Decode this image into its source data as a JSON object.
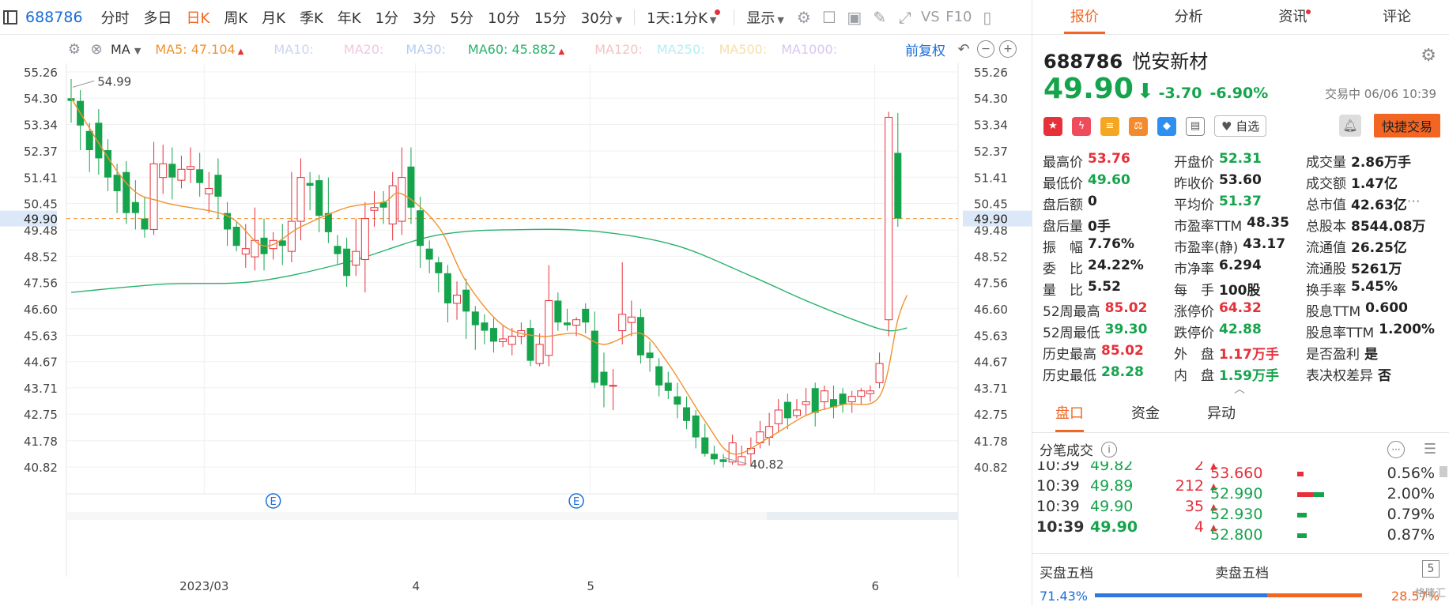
{
  "toolbar": {
    "code": "688786",
    "tabs": [
      "分时",
      "多日",
      "日K",
      "周K",
      "月K",
      "季K",
      "年K",
      "1分",
      "3分",
      "5分",
      "10分",
      "15分",
      "30分"
    ],
    "active_tab": "日K",
    "period": "1天:1分K",
    "display": "显示",
    "vs": "VS",
    "f10": "F10"
  },
  "indicators": {
    "ma_label": "MA",
    "ma5": "MA5: 47.104",
    "ma10": "MA10:",
    "ma20": "MA20:",
    "ma30": "MA30:",
    "ma60": "MA60: 45.882",
    "ma120": "MA120:",
    "ma250": "MA250:",
    "ma500": "MA500:",
    "ma1000": "MA1000:",
    "fuquan": "前复权",
    "colors": {
      "ma5": "#f0922e",
      "ma60": "#27b26b",
      "faded": "#c9d6f0"
    }
  },
  "panel": {
    "tabs": [
      "报价",
      "分析",
      "资讯",
      "评论"
    ],
    "active_tab": "报价",
    "code": "688786",
    "name": "悦安新材",
    "price": "49.90",
    "change": "-3.70",
    "change_pct": "-6.90%",
    "trade_status": "交易中 06/06 10:39",
    "watch": "自选",
    "quick_trade": "快捷交易",
    "stats": [
      [
        {
          "l": "最高价",
          "v": "53.76",
          "c": "red"
        },
        {
          "l": "开盘价",
          "v": "52.31",
          "c": "green"
        },
        {
          "l": "成交量",
          "v": "2.86万手",
          "c": "dark"
        }
      ],
      [
        {
          "l": "最低价",
          "v": "49.60",
          "c": "green"
        },
        {
          "l": "昨收价",
          "v": "53.60",
          "c": "dark"
        },
        {
          "l": "成交额",
          "v": "1.47亿",
          "c": "dark"
        }
      ],
      [
        {
          "l": "盘后额",
          "v": "0",
          "c": "dark"
        },
        {
          "l": "平均价",
          "v": "51.37",
          "c": "green"
        },
        {
          "l": "总市值",
          "v": "42.63亿",
          "c": "dark"
        }
      ],
      [
        {
          "l": "盘后量",
          "v": "0手",
          "c": "dark"
        },
        {
          "l": "市盈率TTM",
          "v": "48.35",
          "c": "dark"
        },
        {
          "l": "总股本",
          "v": "8544.08万",
          "c": "dark"
        }
      ],
      [
        {
          "l": "振　幅",
          "v": "7.76%",
          "c": "dark"
        },
        {
          "l": "市盈率(静)",
          "v": "43.17",
          "c": "dark"
        },
        {
          "l": "流通值",
          "v": "26.25亿",
          "c": "dark"
        }
      ],
      [
        {
          "l": "委　比",
          "v": "24.22%",
          "c": "dark"
        },
        {
          "l": "市净率",
          "v": "6.294",
          "c": "dark"
        },
        {
          "l": "流通股",
          "v": "5261万",
          "c": "dark"
        }
      ],
      [
        {
          "l": "量　比",
          "v": "5.52",
          "c": "dark"
        },
        {
          "l": "每　手",
          "v": "100股",
          "c": "dark"
        },
        {
          "l": "换手率",
          "v": "5.45%",
          "c": "dark"
        }
      ],
      [
        {
          "l": "52周最高",
          "v": "85.02",
          "c": "red"
        },
        {
          "l": "涨停价",
          "v": "64.32",
          "c": "red"
        },
        {
          "l": "股息TTM",
          "v": "0.600",
          "c": "dark"
        }
      ],
      [
        {
          "l": "52周最低",
          "v": "39.30",
          "c": "green"
        },
        {
          "l": "跌停价",
          "v": "42.88",
          "c": "green"
        },
        {
          "l": "股息率TTM",
          "v": "1.200%",
          "c": "dark"
        }
      ],
      [
        {
          "l": "历史最高",
          "v": "85.02",
          "c": "red"
        },
        {
          "l": "外　盘",
          "v": "1.17万手",
          "c": "red"
        },
        {
          "l": "是否盈利",
          "v": "是",
          "c": "dark"
        }
      ],
      [
        {
          "l": "历史最低",
          "v": "28.28",
          "c": "green"
        },
        {
          "l": "内　盘",
          "v": "1.59万手",
          "c": "green"
        },
        {
          "l": "表决权差异",
          "v": "否",
          "c": "dark"
        }
      ]
    ],
    "subtabs": [
      "盘口",
      "资金",
      "异动"
    ],
    "tick_title": "分笔成交",
    "ticks": [
      {
        "t": "10:39",
        "p": "49.82",
        "v": "2"
      },
      {
        "t": "10:39",
        "p": "49.89",
        "v": "212"
      },
      {
        "t": "10:39",
        "p": "49.90",
        "v": "35"
      },
      {
        "t": "10:39",
        "p": "49.90",
        "v": "4"
      }
    ],
    "levels": [
      {
        "p": "53.660",
        "pct": "0.56%"
      },
      {
        "p": "52.990",
        "pct": "2.00%"
      },
      {
        "p": "52.930",
        "pct": "0.79%"
      },
      {
        "p": "52.800",
        "pct": "0.87%"
      }
    ],
    "buy5": "买盘五档",
    "sell5": "卖盘五档",
    "five": "5",
    "buy_pct": "71.43%",
    "sell_pct": "28.57%",
    "watermark": "格隆汇"
  },
  "chart_data": {
    "type": "candlestick",
    "y_ticks": [
      "55.26",
      "54.30",
      "53.34",
      "52.37",
      "51.41",
      "50.45",
      "49.48",
      "48.52",
      "47.56",
      "46.60",
      "45.63",
      "44.67",
      "43.71",
      "42.75",
      "41.78",
      "40.82"
    ],
    "current_price_label": "49.90",
    "high_label": "54.99",
    "low_label": "40.82",
    "x_labels": [
      "2023/03",
      "4",
      "5",
      "6"
    ],
    "candles": [
      [
        54.3,
        54.2,
        55.0,
        53.4
      ],
      [
        54.2,
        53.3,
        54.6,
        52.4
      ],
      [
        53.1,
        52.4,
        53.4,
        51.6
      ],
      [
        53.4,
        52.1,
        53.9,
        51.5
      ],
      [
        52.4,
        51.4,
        52.8,
        50.9
      ],
      [
        51.5,
        50.9,
        51.9,
        50.1
      ],
      [
        51.6,
        50.1,
        52.0,
        49.7
      ],
      [
        50.5,
        50.1,
        51.3,
        49.5
      ],
      [
        49.9,
        49.5,
        50.7,
        49.2
      ],
      [
        49.5,
        51.9,
        52.7,
        49.3
      ],
      [
        51.4,
        51.9,
        52.6,
        50.8
      ],
      [
        51.9,
        51.4,
        52.5,
        50.6
      ],
      [
        51.3,
        51.7,
        52.2,
        51.0
      ],
      [
        51.7,
        51.8,
        52.5,
        51.2
      ],
      [
        51.7,
        51.2,
        52.3,
        50.7
      ],
      [
        50.8,
        51.0,
        51.6,
        50.1
      ],
      [
        51.5,
        50.7,
        52.1,
        49.9
      ],
      [
        50.1,
        49.5,
        50.5,
        48.9
      ],
      [
        49.6,
        48.9,
        49.8,
        48.7
      ],
      [
        48.6,
        48.8,
        49.7,
        48.1
      ],
      [
        48.5,
        49.1,
        50.3,
        48.0
      ],
      [
        49.2,
        48.6,
        49.9,
        48.0
      ],
      [
        48.8,
        49.1,
        49.4,
        48.4
      ],
      [
        49.1,
        48.9,
        49.7,
        48.2
      ],
      [
        48.7,
        49.8,
        51.6,
        48.3
      ],
      [
        49.8,
        51.4,
        52.1,
        49.1
      ],
      [
        51.2,
        51.1,
        51.6,
        50.2
      ],
      [
        51.3,
        50.0,
        51.5,
        49.4
      ],
      [
        50.1,
        49.4,
        51.4,
        49.0
      ],
      [
        48.9,
        48.6,
        49.3,
        48.2
      ],
      [
        48.8,
        47.8,
        49.2,
        47.4
      ],
      [
        48.2,
        48.7,
        49.9,
        47.8
      ],
      [
        48.4,
        49.9,
        50.5,
        47.2
      ],
      [
        50.2,
        50.3,
        50.9,
        49.6
      ],
      [
        50.5,
        50.3,
        50.9,
        49.7
      ],
      [
        49.7,
        51.1,
        51.6,
        49.1
      ],
      [
        49.8,
        51.4,
        52.5,
        49.3
      ],
      [
        51.8,
        50.3,
        52.5,
        49.7
      ],
      [
        50.2,
        48.9,
        50.7,
        48.1
      ],
      [
        48.8,
        48.4,
        49.1,
        47.9
      ],
      [
        48.3,
        47.9,
        48.5,
        47.2
      ],
      [
        47.9,
        46.8,
        48.2,
        46.1
      ],
      [
        46.8,
        47.1,
        47.6,
        46.2
      ],
      [
        47.3,
        46.5,
        47.7,
        45.5
      ],
      [
        46.5,
        46.0,
        46.7,
        45.1
      ],
      [
        46.1,
        45.8,
        46.4,
        45.3
      ],
      [
        45.9,
        45.4,
        46.3,
        45.0
      ],
      [
        45.4,
        45.5,
        46.0,
        45.2
      ],
      [
        45.3,
        45.6,
        45.9,
        44.9
      ],
      [
        45.6,
        45.8,
        46.1,
        45.3
      ],
      [
        45.9,
        44.7,
        46.2,
        44.5
      ],
      [
        44.6,
        45.3,
        45.7,
        44.5
      ],
      [
        44.9,
        46.9,
        48.2,
        44.5
      ],
      [
        46.9,
        46.1,
        47.2,
        45.8
      ],
      [
        46.1,
        46.0,
        46.6,
        45.8
      ],
      [
        46.0,
        46.2,
        46.3,
        45.6
      ],
      [
        46.6,
        46.1,
        46.8,
        45.7
      ],
      [
        45.8,
        43.9,
        46.5,
        43.7
      ],
      [
        44.3,
        43.8,
        45.0,
        43.0
      ],
      [
        43.8,
        43.8,
        44.4,
        42.9
      ],
      [
        45.8,
        46.4,
        48.3,
        45.3
      ],
      [
        46.1,
        46.3,
        46.9,
        45.6
      ],
      [
        46.3,
        44.9,
        46.6,
        44.6
      ],
      [
        45.0,
        44.8,
        45.4,
        44.3
      ],
      [
        44.5,
        43.8,
        44.8,
        43.4
      ],
      [
        43.9,
        43.6,
        44.3,
        43.3
      ],
      [
        43.4,
        43.1,
        43.9,
        42.6
      ],
      [
        43.0,
        42.5,
        43.4,
        42.2
      ],
      [
        42.7,
        41.9,
        42.9,
        41.5
      ],
      [
        41.9,
        41.3,
        42.4,
        41.2
      ],
      [
        41.3,
        41.1,
        41.6,
        40.9
      ],
      [
        41.1,
        41.0,
        41.3,
        40.8
      ],
      [
        41.0,
        41.7,
        42.0,
        40.9
      ],
      [
        40.9,
        41.2,
        41.6,
        40.9
      ],
      [
        41.3,
        41.5,
        41.9,
        40.9
      ],
      [
        41.7,
        42.1,
        42.5,
        41.5
      ],
      [
        41.9,
        42.3,
        42.8,
        41.6
      ],
      [
        42.4,
        42.9,
        43.3,
        42.1
      ],
      [
        43.2,
        42.6,
        43.5,
        42.2
      ],
      [
        42.7,
        42.9,
        43.3,
        42.6
      ],
      [
        43.1,
        43.2,
        43.7,
        42.7
      ],
      [
        43.7,
        42.8,
        43.9,
        42.3
      ],
      [
        43.2,
        43.6,
        43.8,
        42.9
      ],
      [
        43.3,
        43.0,
        43.8,
        42.6
      ],
      [
        43.5,
        43.1,
        43.7,
        42.8
      ],
      [
        43.2,
        43.4,
        43.6,
        42.8
      ],
      [
        43.4,
        43.6,
        43.7,
        43.1
      ],
      [
        43.5,
        43.6,
        43.8,
        43.2
      ],
      [
        43.9,
        44.6,
        45.0,
        43.7
      ],
      [
        46.2,
        53.6,
        53.8,
        45.6
      ],
      [
        52.3,
        49.9,
        53.76,
        49.6
      ]
    ],
    "ma5_anchors": [
      [
        0,
        54.3
      ],
      [
        6,
        51.2
      ],
      [
        10,
        50.5
      ],
      [
        17,
        50.0
      ],
      [
        21,
        48.9
      ],
      [
        25,
        49.6
      ],
      [
        30,
        50.3
      ],
      [
        34,
        50.5
      ],
      [
        36,
        50.8
      ],
      [
        40,
        49.6
      ],
      [
        43,
        47.6
      ],
      [
        47,
        46.0
      ],
      [
        51,
        45.6
      ],
      [
        55,
        45.7
      ],
      [
        58,
        45.3
      ],
      [
        62,
        45.7
      ],
      [
        65,
        44.6
      ],
      [
        69,
        42.5
      ],
      [
        72,
        41.3
      ],
      [
        76,
        41.9
      ],
      [
        80,
        42.7
      ],
      [
        84,
        43.1
      ],
      [
        88,
        43.4
      ],
      [
        90,
        46.2
      ],
      [
        91,
        47.1
      ]
    ],
    "ma60_anchors": [
      [
        0,
        47.2
      ],
      [
        10,
        47.5
      ],
      [
        20,
        47.6
      ],
      [
        30,
        48.3
      ],
      [
        40,
        49.3
      ],
      [
        50,
        49.5
      ],
      [
        58,
        49.4
      ],
      [
        66,
        48.9
      ],
      [
        74,
        47.8
      ],
      [
        80,
        46.9
      ],
      [
        86,
        46.1
      ],
      [
        89,
        45.8
      ],
      [
        91,
        45.9
      ]
    ],
    "signal_marks": [
      [
        2,
        "#1a6ed8"
      ],
      [
        3,
        "#1a6ed8"
      ],
      [
        4,
        "#1a6ed8"
      ],
      [
        5,
        "#1a6ed8"
      ],
      [
        10,
        "#1a6ed8"
      ],
      [
        11,
        "#1a6ed8"
      ],
      [
        12,
        "#1a6ed8"
      ],
      [
        13,
        "#1a6ed8"
      ],
      [
        19,
        "#1a6ed8"
      ],
      [
        22,
        "#1a6ed8"
      ],
      [
        25,
        "#1a6ed8"
      ],
      [
        26,
        "#1a6ed8"
      ],
      [
        34,
        "#1a6ed8"
      ],
      [
        35,
        "#1a6ed8"
      ],
      [
        41,
        "#1a6ed8"
      ],
      [
        45,
        "#1a6ed8"
      ],
      [
        46,
        "#1a6ed8"
      ],
      [
        53,
        "#1a6ed8"
      ],
      [
        54,
        "#1a6ed8"
      ],
      [
        63,
        "#1a6ed8"
      ],
      [
        67,
        "#1a6ed8"
      ],
      [
        68,
        "#1a6ed8"
      ],
      [
        69,
        "#1a6ed8"
      ],
      [
        70,
        "#1a6ed8"
      ],
      [
        74,
        "#1a6ed8"
      ],
      [
        83,
        "#1a6ed8"
      ],
      [
        84,
        "#1a6ed8"
      ]
    ],
    "event_marks": [
      22,
      55
    ],
    "event_label": "E",
    "ylim": [
      40.82,
      55.26
    ]
  }
}
